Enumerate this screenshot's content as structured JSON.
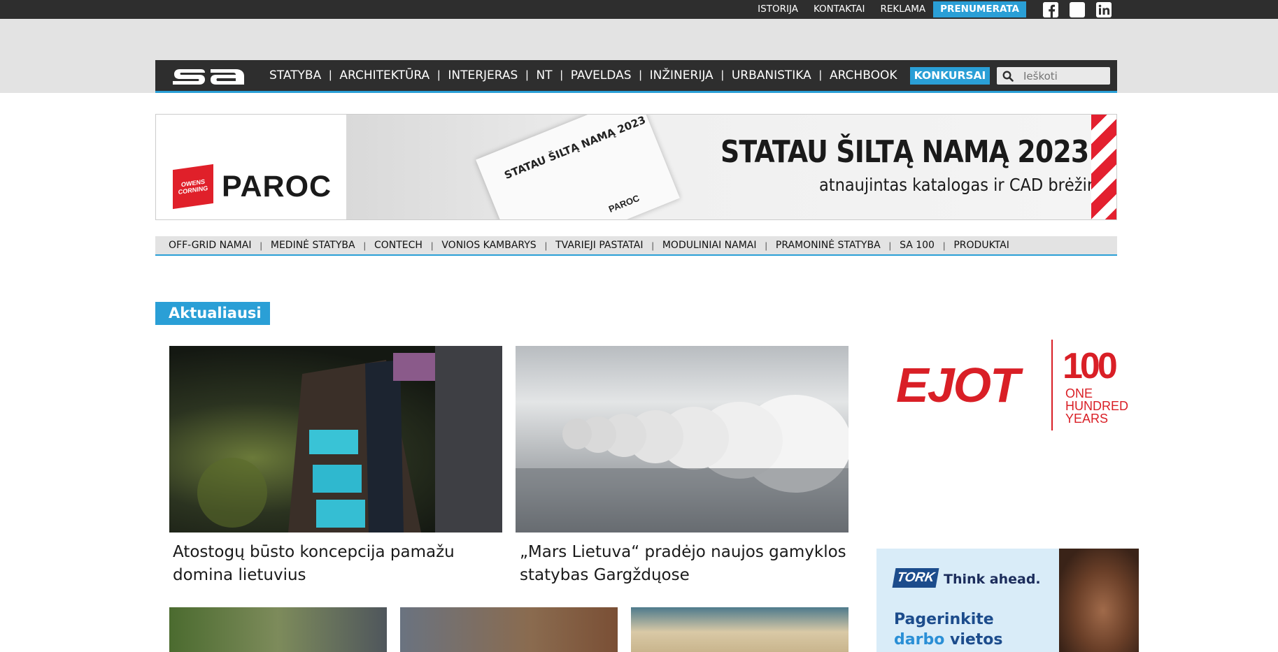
{
  "topbar": {
    "links": [
      "ISTORIJA",
      "KONTAKTAI",
      "REKLAMA"
    ],
    "subscribe_label": "PRENUMERATA",
    "social": [
      "facebook-icon",
      "instagram-icon",
      "linkedin-icon"
    ]
  },
  "nav": {
    "logo_text": "sa",
    "items": [
      "STATYBA",
      "ARCHITEKTŪRA",
      "INTERJERAS",
      "NT",
      "PAVELDAS",
      "INŽINERIJA",
      "URBANISTIKA",
      "ARCHBOOK"
    ],
    "cta_label": "KONKURSAI",
    "search_placeholder": "Ieškoti"
  },
  "banner": {
    "brand_small": "OWENS CORNING",
    "brand": "PAROC",
    "catalog_title": "STATAU ŠILTĄ NAMĄ 2023",
    "catalog_brand": "PAROC",
    "headline": "STATAU ŠILTĄ NAMĄ 2023",
    "subline": "atnaujintas katalogas ir CAD brėžiniai"
  },
  "subnav": {
    "items": [
      "OFF-GRID NAMAI",
      "MEDINĖ STATYBA",
      "CONTECH",
      "VONIOS KAMBARYS",
      "TVARIEJI PASTATAI",
      "MODULINIAI NAMAI",
      "PRAMONINĖ STATYBA",
      "SA 100",
      "PRODUKTAI"
    ]
  },
  "section": {
    "title": "Aktualiausi"
  },
  "articles": [
    {
      "title": "Atostogų būsto koncepcija pamažu domina lietuvius"
    },
    {
      "title": "„Mars Lietuva“ pradėjo naujos gamyklos statybas Gargždųose"
    }
  ],
  "ads": {
    "ejot": {
      "brand": "EJOT",
      "number": "100",
      "tagline": "ONE HUNDRED YEARS"
    },
    "tork": {
      "brand": "TORK",
      "slogan": "Think ahead.",
      "headline_1": "Pagerinkite ",
      "headline_highlight": "darbo",
      "headline_2": " vietos aplinką"
    }
  },
  "colors": {
    "accent": "#2a9fd6",
    "dark": "#2e2e2e",
    "ejot_red": "#d91f26",
    "paroc_red": "#e3202f"
  }
}
